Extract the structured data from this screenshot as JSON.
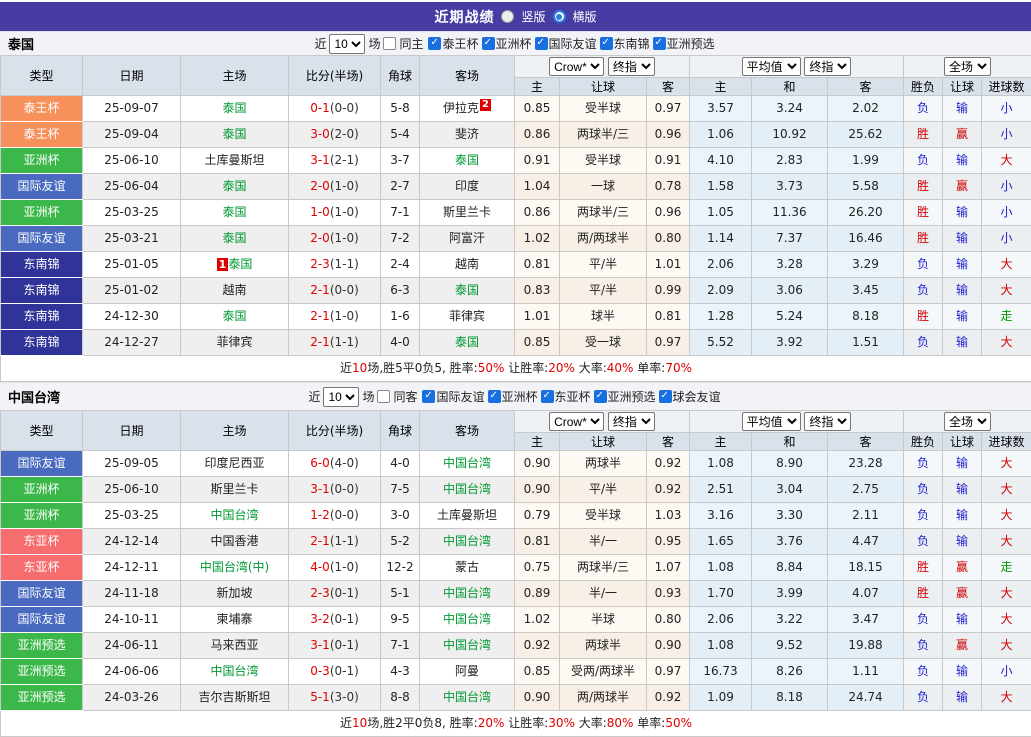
{
  "title_bar": {
    "title": "近期战绩",
    "vertical": "竖版",
    "horizontal": "横版"
  },
  "labels": {
    "near": "近",
    "matches": "场"
  },
  "dropdowns": {
    "crow": "Crow*",
    "final": "终指",
    "average": "平均值",
    "full": "全场"
  },
  "columns": {
    "type": "类型",
    "date": "日期",
    "home": "主场",
    "score": "比分(半场)",
    "corner": "角球",
    "away": "客场",
    "h": "主",
    "handicap": "让球",
    "a": "客",
    "avg_h": "主",
    "avg_d": "和",
    "avg_a": "客",
    "result": "胜负",
    "handicap_r": "让球",
    "goals": "进球数"
  },
  "colors": {
    "red": "#d10000",
    "blue": "#2121cc",
    "green": "#009900",
    "team_green": "#009933",
    "score_red": "#e00000",
    "mark_red": "#dd0000",
    "topbar_purple": "#473ca3",
    "badge": {
      "泰王杯": "#f6915c",
      "亚洲杯": "#3cb84a",
      "国际友谊": "#4a6ac0",
      "东南锦": "#303499",
      "东亚杯": "#f66d6d",
      "亚洲预选": "#3cb84a"
    },
    "result": {
      "胜": "red",
      "负": "blue",
      "赢": "red",
      "输": "blue",
      "大": "red",
      "小": "blue",
      "走": "green"
    }
  },
  "sections": [
    {
      "team": "泰国",
      "filter": {
        "games": "10",
        "same_label": "同主",
        "leagues": [
          "泰王杯",
          "亚洲杯",
          "国际友谊",
          "东南锦",
          "亚洲预选"
        ]
      },
      "rows": [
        {
          "type": "泰王杯",
          "date": "25-09-07",
          "home": "泰国",
          "home_main": true,
          "score": "0-1",
          "half": "(0-0)",
          "corner": "5-8",
          "away": "伊拉克",
          "away_badge": "2",
          "c1": "0.85",
          "hcap": "受半球",
          "c2": "0.97",
          "a1": "3.57",
          "a2": "3.24",
          "a3": "2.02",
          "r1": "负",
          "r2": "输",
          "r3": "小"
        },
        {
          "type": "泰王杯",
          "date": "25-09-04",
          "home": "泰国",
          "home_main": true,
          "score": "3-0",
          "half": "(2-0)",
          "corner": "5-4",
          "away": "斐济",
          "c1": "0.86",
          "hcap": "两球半/三",
          "c2": "0.96",
          "a1": "1.06",
          "a2": "10.92",
          "a3": "25.62",
          "r1": "胜",
          "r2": "赢",
          "r3": "小"
        },
        {
          "type": "亚洲杯",
          "date": "25-06-10",
          "home": "土库曼斯坦",
          "score": "3-1",
          "half": "(2-1)",
          "corner": "3-7",
          "away": "泰国",
          "away_main": true,
          "c1": "0.91",
          "hcap": "受半球",
          "c2": "0.91",
          "a1": "4.10",
          "a2": "2.83",
          "a3": "1.99",
          "r1": "负",
          "r2": "输",
          "r3": "大"
        },
        {
          "type": "国际友谊",
          "date": "25-06-04",
          "home": "泰国",
          "home_main": true,
          "score": "2-0",
          "half": "(1-0)",
          "corner": "2-7",
          "away": "印度",
          "c1": "1.04",
          "hcap": "一球",
          "c2": "0.78",
          "a1": "1.58",
          "a2": "3.73",
          "a3": "5.58",
          "r1": "胜",
          "r2": "赢",
          "r3": "小"
        },
        {
          "type": "亚洲杯",
          "date": "25-03-25",
          "home": "泰国",
          "home_main": true,
          "score": "1-0",
          "half": "(1-0)",
          "corner": "7-1",
          "away": "斯里兰卡",
          "c1": "0.86",
          "hcap": "两球半/三",
          "c2": "0.96",
          "a1": "1.05",
          "a2": "11.36",
          "a3": "26.20",
          "r1": "胜",
          "r2": "输",
          "r3": "小"
        },
        {
          "type": "国际友谊",
          "date": "25-03-21",
          "home": "泰国",
          "home_main": true,
          "score": "2-0",
          "half": "(1-0)",
          "corner": "7-2",
          "away": "阿富汗",
          "c1": "1.02",
          "hcap": "两/两球半",
          "c2": "0.80",
          "a1": "1.14",
          "a2": "7.37",
          "a3": "16.46",
          "r1": "胜",
          "r2": "输",
          "r3": "小"
        },
        {
          "type": "东南锦",
          "date": "25-01-05",
          "home": "泰国",
          "home_main": true,
          "home_badge": "1",
          "score": "2-3",
          "half": "(1-1)",
          "corner": "2-4",
          "away": "越南",
          "c1": "0.81",
          "hcap": "平/半",
          "c2": "1.01",
          "a1": "2.06",
          "a2": "3.28",
          "a3": "3.29",
          "r1": "负",
          "r2": "输",
          "r3": "大"
        },
        {
          "type": "东南锦",
          "date": "25-01-02",
          "home": "越南",
          "score": "2-1",
          "half": "(0-0)",
          "corner": "6-3",
          "away": "泰国",
          "away_main": true,
          "c1": "0.83",
          "hcap": "平/半",
          "c2": "0.99",
          "a1": "2.09",
          "a2": "3.06",
          "a3": "3.45",
          "r1": "负",
          "r2": "输",
          "r3": "大"
        },
        {
          "type": "东南锦",
          "date": "24-12-30",
          "home": "泰国",
          "home_main": true,
          "score": "2-1",
          "half": "(1-0)",
          "corner": "1-6",
          "away": "菲律宾",
          "c1": "1.01",
          "hcap": "球半",
          "c2": "0.81",
          "a1": "1.28",
          "a2": "5.24",
          "a3": "8.18",
          "r1": "胜",
          "r2": "输",
          "r3": "走"
        },
        {
          "type": "东南锦",
          "date": "24-12-27",
          "home": "菲律宾",
          "score": "2-1",
          "half": "(1-1)",
          "corner": "4-0",
          "away": "泰国",
          "away_main": true,
          "c1": "0.85",
          "hcap": "受一球",
          "c2": "0.97",
          "a1": "5.52",
          "a2": "3.92",
          "a3": "1.51",
          "r1": "负",
          "r2": "输",
          "r3": "大"
        }
      ],
      "summary": [
        {
          "t": "近"
        },
        {
          "t": "10",
          "red": true
        },
        {
          "t": "场,胜5平0负5, 胜率:"
        },
        {
          "t": "50%",
          "red": true
        },
        {
          "t": " 让胜率:"
        },
        {
          "t": "20%",
          "red": true
        },
        {
          "t": " 大率:"
        },
        {
          "t": "40%",
          "red": true
        },
        {
          "t": " 单率:"
        },
        {
          "t": "70%",
          "red": true
        }
      ]
    },
    {
      "team": "中国台湾",
      "filter": {
        "games": "10",
        "same_label": "同客",
        "leagues": [
          "国际友谊",
          "亚洲杯",
          "东亚杯",
          "亚洲预选",
          "球会友谊"
        ]
      },
      "rows": [
        {
          "type": "国际友谊",
          "date": "25-09-05",
          "home": "印度尼西亚",
          "score": "6-0",
          "half": "(4-0)",
          "corner": "4-0",
          "away": "中国台湾",
          "away_main": true,
          "c1": "0.90",
          "hcap": "两球半",
          "c2": "0.92",
          "a1": "1.08",
          "a2": "8.90",
          "a3": "23.28",
          "r1": "负",
          "r2": "输",
          "r3": "大"
        },
        {
          "type": "亚洲杯",
          "date": "25-06-10",
          "home": "斯里兰卡",
          "score": "3-1",
          "half": "(0-0)",
          "corner": "7-5",
          "away": "中国台湾",
          "away_main": true,
          "c1": "0.90",
          "hcap": "平/半",
          "c2": "0.92",
          "a1": "2.51",
          "a2": "3.04",
          "a3": "2.75",
          "r1": "负",
          "r2": "输",
          "r3": "大"
        },
        {
          "type": "亚洲杯",
          "date": "25-03-25",
          "home": "中国台湾",
          "home_main": true,
          "score": "1-2",
          "half": "(0-0)",
          "corner": "3-0",
          "away": "土库曼斯坦",
          "c1": "0.79",
          "hcap": "受半球",
          "c2": "1.03",
          "a1": "3.16",
          "a2": "3.30",
          "a3": "2.11",
          "r1": "负",
          "r2": "输",
          "r3": "大"
        },
        {
          "type": "东亚杯",
          "date": "24-12-14",
          "home": "中国香港",
          "score": "2-1",
          "half": "(1-1)",
          "corner": "5-2",
          "away": "中国台湾",
          "away_main": true,
          "c1": "0.81",
          "hcap": "半/一",
          "c2": "0.95",
          "a1": "1.65",
          "a2": "3.76",
          "a3": "4.47",
          "r1": "负",
          "r2": "输",
          "r3": "大"
        },
        {
          "type": "东亚杯",
          "date": "24-12-11",
          "home": "中国台湾(中)",
          "home_main": true,
          "score": "4-0",
          "half": "(1-0)",
          "corner": "12-2",
          "away": "蒙古",
          "c1": "0.75",
          "hcap": "两球半/三",
          "c2": "1.07",
          "a1": "1.08",
          "a2": "8.84",
          "a3": "18.15",
          "r1": "胜",
          "r2": "赢",
          "r3": "走"
        },
        {
          "type": "国际友谊",
          "date": "24-11-18",
          "home": "新加坡",
          "score": "2-3",
          "half": "(0-1)",
          "corner": "5-1",
          "away": "中国台湾",
          "away_main": true,
          "c1": "0.89",
          "hcap": "半/一",
          "c2": "0.93",
          "a1": "1.70",
          "a2": "3.99",
          "a3": "4.07",
          "r1": "胜",
          "r2": "赢",
          "r3": "大"
        },
        {
          "type": "国际友谊",
          "date": "24-10-11",
          "home": "柬埔寨",
          "score": "3-2",
          "half": "(0-1)",
          "corner": "9-5",
          "away": "中国台湾",
          "away_main": true,
          "c1": "1.02",
          "hcap": "半球",
          "c2": "0.80",
          "a1": "2.06",
          "a2": "3.22",
          "a3": "3.47",
          "r1": "负",
          "r2": "输",
          "r3": "大"
        },
        {
          "type": "亚洲预选",
          "date": "24-06-11",
          "home": "马来西亚",
          "score": "3-1",
          "half": "(0-1)",
          "corner": "7-1",
          "away": "中国台湾",
          "away_main": true,
          "c1": "0.92",
          "hcap": "两球半",
          "c2": "0.90",
          "a1": "1.08",
          "a2": "9.52",
          "a3": "19.88",
          "r1": "负",
          "r2": "赢",
          "r3": "大"
        },
        {
          "type": "亚洲预选",
          "date": "24-06-06",
          "home": "中国台湾",
          "home_main": true,
          "score": "0-3",
          "half": "(0-1)",
          "corner": "4-3",
          "away": "阿曼",
          "c1": "0.85",
          "hcap": "受两/两球半",
          "c2": "0.97",
          "a1": "16.73",
          "a2": "8.26",
          "a3": "1.11",
          "r1": "负",
          "r2": "输",
          "r3": "小"
        },
        {
          "type": "亚洲预选",
          "date": "24-03-26",
          "home": "吉尔吉斯斯坦",
          "score": "5-1",
          "half": "(3-0)",
          "corner": "8-8",
          "away": "中国台湾",
          "away_main": true,
          "c1": "0.90",
          "hcap": "两/两球半",
          "c2": "0.92",
          "a1": "1.09",
          "a2": "8.18",
          "a3": "24.74",
          "r1": "负",
          "r2": "输",
          "r3": "大"
        }
      ],
      "summary": [
        {
          "t": "近"
        },
        {
          "t": "10",
          "red": true
        },
        {
          "t": "场,胜2平0负8, 胜率:"
        },
        {
          "t": "20%",
          "red": true
        },
        {
          "t": " 让胜率:"
        },
        {
          "t": "30%",
          "red": true
        },
        {
          "t": " 大率:"
        },
        {
          "t": "80%",
          "red": true
        },
        {
          "t": " 单率:"
        },
        {
          "t": "50%",
          "red": true
        }
      ]
    }
  ]
}
